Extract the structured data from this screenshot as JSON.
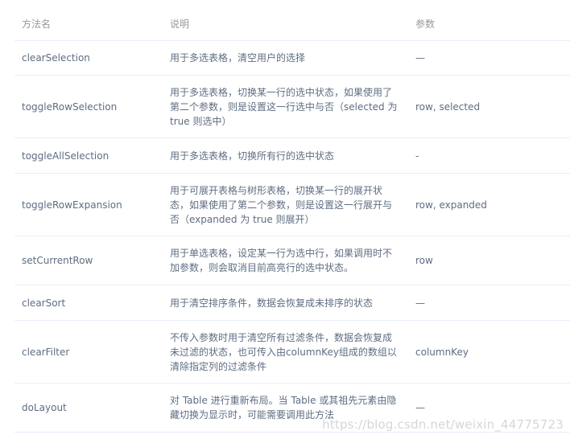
{
  "table": {
    "headers": {
      "name": "方法名",
      "description": "说明",
      "params": "参数"
    },
    "rows": [
      {
        "name": "clearSelection",
        "description": "用于多选表格，清空用户的选择",
        "params": "—"
      },
      {
        "name": "toggleRowSelection",
        "description": "用于多选表格，切换某一行的选中状态，如果使用了第二个参数，则是设置这一行选中与否（selected 为 true 则选中）",
        "params": "row, selected"
      },
      {
        "name": "toggleAllSelection",
        "description": "用于多选表格，切换所有行的选中状态",
        "params": "-"
      },
      {
        "name": "toggleRowExpansion",
        "description": "用于可展开表格与树形表格，切换某一行的展开状态，如果使用了第二个参数，则是设置这一行展开与否（expanded 为 true 则展开）",
        "params": "row, expanded"
      },
      {
        "name": "setCurrentRow",
        "description": "用于单选表格，设定某一行为选中行，如果调用时不加参数，则会取消目前高亮行的选中状态。",
        "params": "row"
      },
      {
        "name": "clearSort",
        "description": "用于清空排序条件，数据会恢复成未排序的状态",
        "params": "—"
      },
      {
        "name": "clearFilter",
        "description": "不传入参数时用于清空所有过滤条件，数据会恢复成未过滤的状态，也可传入由columnKey组成的数组以清除指定列的过滤条件",
        "params": "columnKey"
      },
      {
        "name": "doLayout",
        "description": "对 Table 进行重新布局。当 Table 或其祖先元素由隐藏切换为显示时，可能需要调用此方法",
        "params": "—"
      }
    ]
  },
  "watermark": "https://blog.csdn.net/weixin_44775723"
}
